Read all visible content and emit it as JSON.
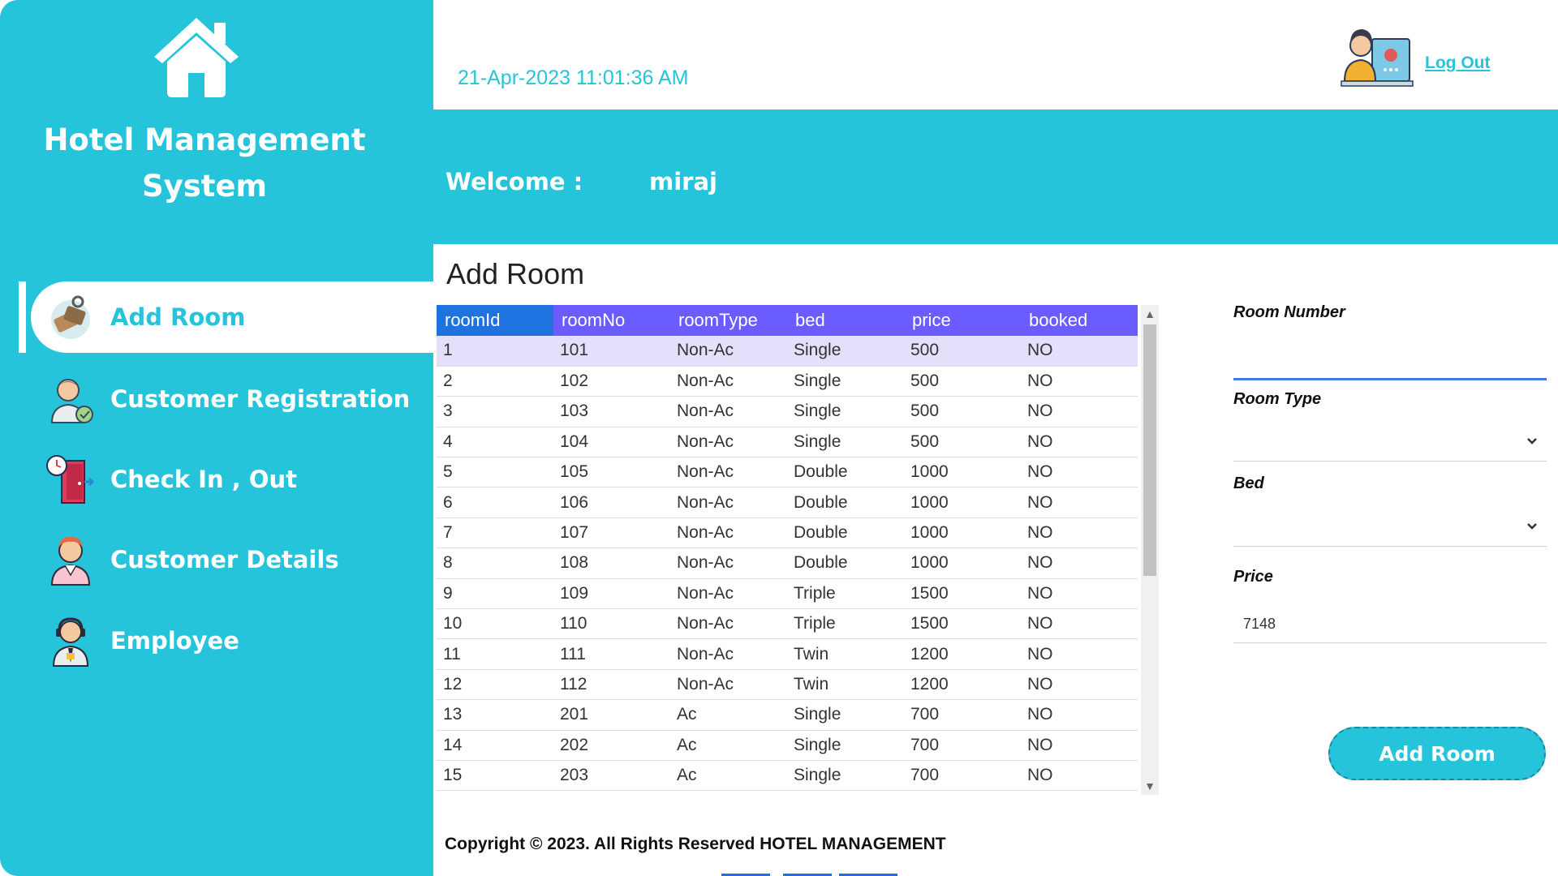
{
  "app": {
    "title": "Hotel Management System",
    "accent_color": "#26c4da",
    "header_color": "#6a5cff"
  },
  "header": {
    "datetime": "21-Apr-2023 11:01:36 AM",
    "logout_label": "Log Out",
    "welcome_label": "Welcome :",
    "username": "miraj"
  },
  "nav": {
    "items": [
      {
        "label": "Add Room",
        "icon": "room-key-icon",
        "active": true
      },
      {
        "label": "Customer Registration",
        "icon": "customer-registration-icon",
        "active": false
      },
      {
        "label": "Check In , Out",
        "icon": "check-in-out-icon",
        "active": false
      },
      {
        "label": "Customer Details",
        "icon": "customer-details-icon",
        "active": false
      },
      {
        "label": "Employee",
        "icon": "employee-icon",
        "active": false
      }
    ]
  },
  "main": {
    "page_title": "Add Room",
    "table": {
      "columns": [
        "roomId",
        "roomNo",
        "roomType",
        "bed",
        "price",
        "booked"
      ],
      "rows": [
        [
          "1",
          "101",
          "Non-Ac",
          "Single",
          "500",
          "NO"
        ],
        [
          "2",
          "102",
          "Non-Ac",
          "Single",
          "500",
          "NO"
        ],
        [
          "3",
          "103",
          "Non-Ac",
          "Single",
          "500",
          "NO"
        ],
        [
          "4",
          "104",
          "Non-Ac",
          "Single",
          "500",
          "NO"
        ],
        [
          "5",
          "105",
          "Non-Ac",
          "Double",
          "1000",
          "NO"
        ],
        [
          "6",
          "106",
          "Non-Ac",
          "Double",
          "1000",
          "NO"
        ],
        [
          "7",
          "107",
          "Non-Ac",
          "Double",
          "1000",
          "NO"
        ],
        [
          "8",
          "108",
          "Non-Ac",
          "Double",
          "1000",
          "NO"
        ],
        [
          "9",
          "109",
          "Non-Ac",
          "Triple",
          "1500",
          "NO"
        ],
        [
          "10",
          "110",
          "Non-Ac",
          "Triple",
          "1500",
          "NO"
        ],
        [
          "11",
          "111",
          "Non-Ac",
          "Twin",
          "1200",
          "NO"
        ],
        [
          "12",
          "112",
          "Non-Ac",
          "Twin",
          "1200",
          "NO"
        ],
        [
          "13",
          "201",
          "Ac",
          "Single",
          "700",
          "NO"
        ],
        [
          "14",
          "202",
          "Ac",
          "Single",
          "700",
          "NO"
        ],
        [
          "15",
          "203",
          "Ac",
          "Single",
          "700",
          "NO"
        ]
      ],
      "selected_row": 0
    },
    "form": {
      "room_number_label": "Room Number",
      "room_number_value": "",
      "room_type_label": "Room Type",
      "room_type_value": "",
      "bed_label": "Bed",
      "bed_value": "",
      "price_label": "Price",
      "price_value": "7148",
      "submit_label": "Add Room"
    },
    "copyright": "Copyright © 2023. All Rights Reserved HOTEL MANAGEMENT"
  }
}
